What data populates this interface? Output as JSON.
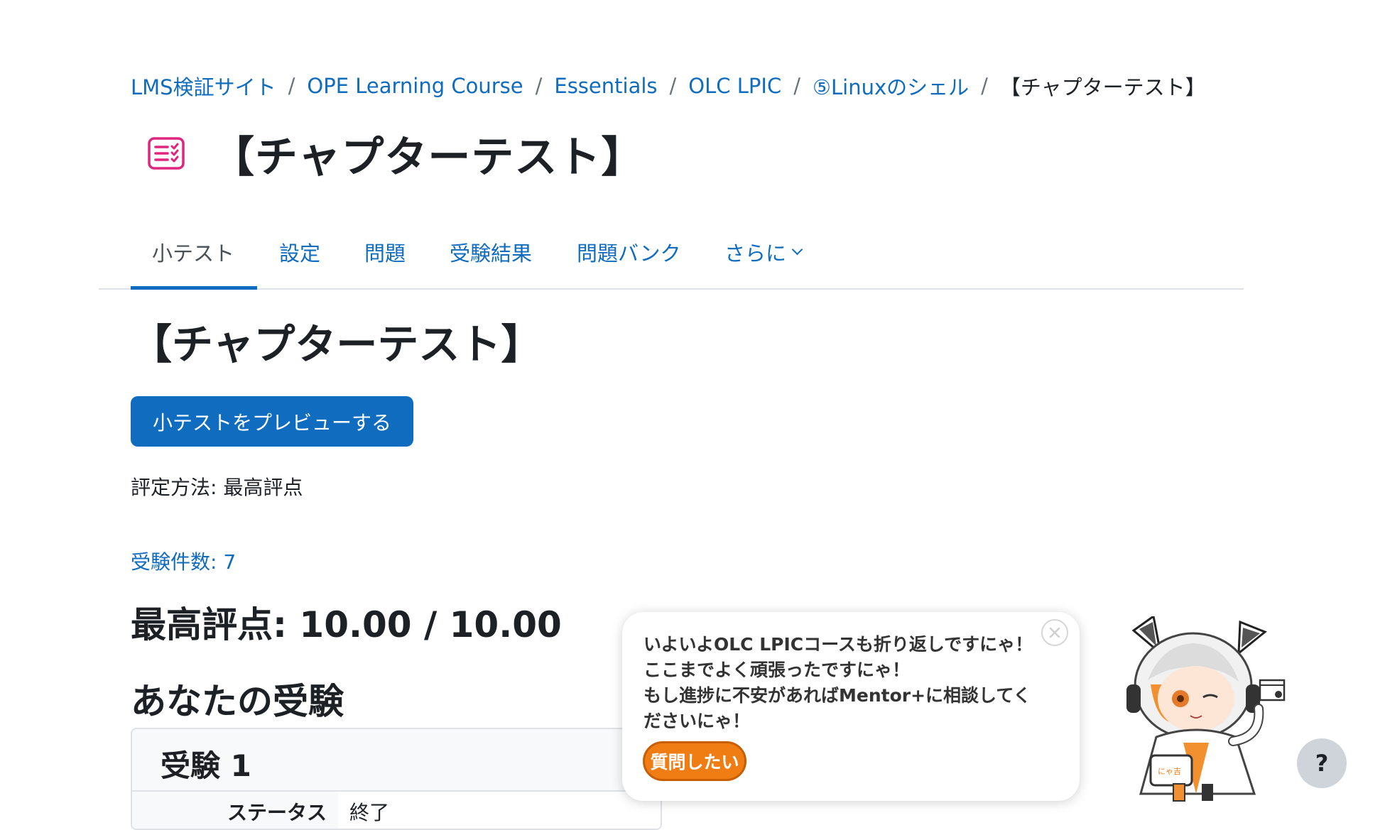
{
  "breadcrumb": {
    "items": [
      "LMS検証サイト",
      "OPE Learning Course",
      "Essentials",
      "OLC LPIC",
      "⑤Linuxのシェル"
    ],
    "separator": "/",
    "current": "【チャプターテスト】"
  },
  "header": {
    "icon": "quiz-icon",
    "title": "【チャプターテスト】"
  },
  "tabs": [
    {
      "label": "小テスト",
      "active": true
    },
    {
      "label": "設定"
    },
    {
      "label": "問題"
    },
    {
      "label": "受験結果"
    },
    {
      "label": "問題バンク"
    },
    {
      "label": "さらに",
      "icon": "chevron-down-icon"
    }
  ],
  "main": {
    "title": "【チャプターテスト】",
    "preview_button": "小テストをプレビューする",
    "grading_method": "評定方法: 最高評点",
    "attempts_link": "受験件数: 7",
    "best_grade": "最高評点: 10.00 / 10.00",
    "your_attempts_heading": "あなたの受験",
    "attempt": {
      "title": "受験 1",
      "status_label": "ステータス",
      "status_value": "終了"
    }
  },
  "chat": {
    "message": "いよいよOLC LPICコースも折り返しですにゃ！ここまでよく頑張ったですにゃ！\nもし進捗に不安があればMentor+に相談してくださいにゃ！",
    "ask_button": "質問したい",
    "close_icon": "close-icon",
    "mascot_badge": "にゃ吉"
  },
  "help": {
    "label": "?"
  },
  "colors": {
    "link": "#0f6cbf",
    "text": "#1d2125",
    "quiz_icon": "#e0257f",
    "chat_button": "#f07d14",
    "tab_underline": "#0f6cbf"
  }
}
